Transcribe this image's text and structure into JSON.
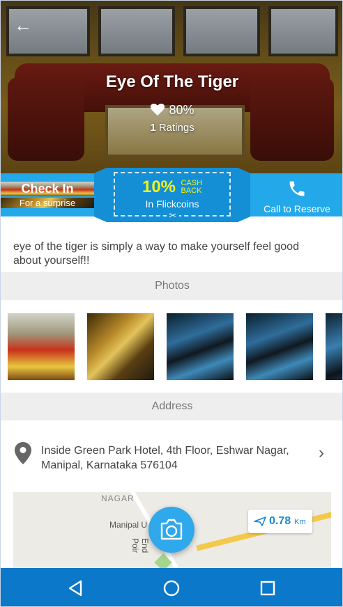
{
  "header": {
    "title": "Eye Of The Tiger",
    "rating_percent": "80%",
    "ratings_count": "1",
    "ratings_label": "Ratings",
    "back_icon": "back-arrow-icon"
  },
  "actions": {
    "checkin_title": "Check In",
    "checkin_subtitle": "For a surprise",
    "cashback_percent": "10%",
    "cashback_line1": "CASH",
    "cashback_line2": "BACK",
    "cashback_subtitle": "In Flickcoins",
    "call_label": "Call to Reserve",
    "colors": {
      "strip": "#23a8ea",
      "coupon": "#148fd6",
      "highlight": "#f2f21c"
    }
  },
  "description": "eye of the tiger is simply a way to make yourself feel good about yourself!!",
  "photos": {
    "heading": "Photos",
    "count_visible": 5
  },
  "address": {
    "heading": "Address",
    "line1": "Inside Green Park Hotel, 4th Floor, Eshwar Nagar,",
    "line2": "Manipal, Karnataka 576104"
  },
  "map": {
    "label_nagar": "NAGAR",
    "label_manipal": "Manipal U",
    "label_end": "End Poir",
    "distance_value": "0.78",
    "distance_unit": "Km"
  },
  "navbar": {
    "back_icon": "nav-back-icon",
    "home_icon": "nav-home-icon",
    "recent_icon": "nav-recent-icon",
    "color": "#0b78c9"
  }
}
